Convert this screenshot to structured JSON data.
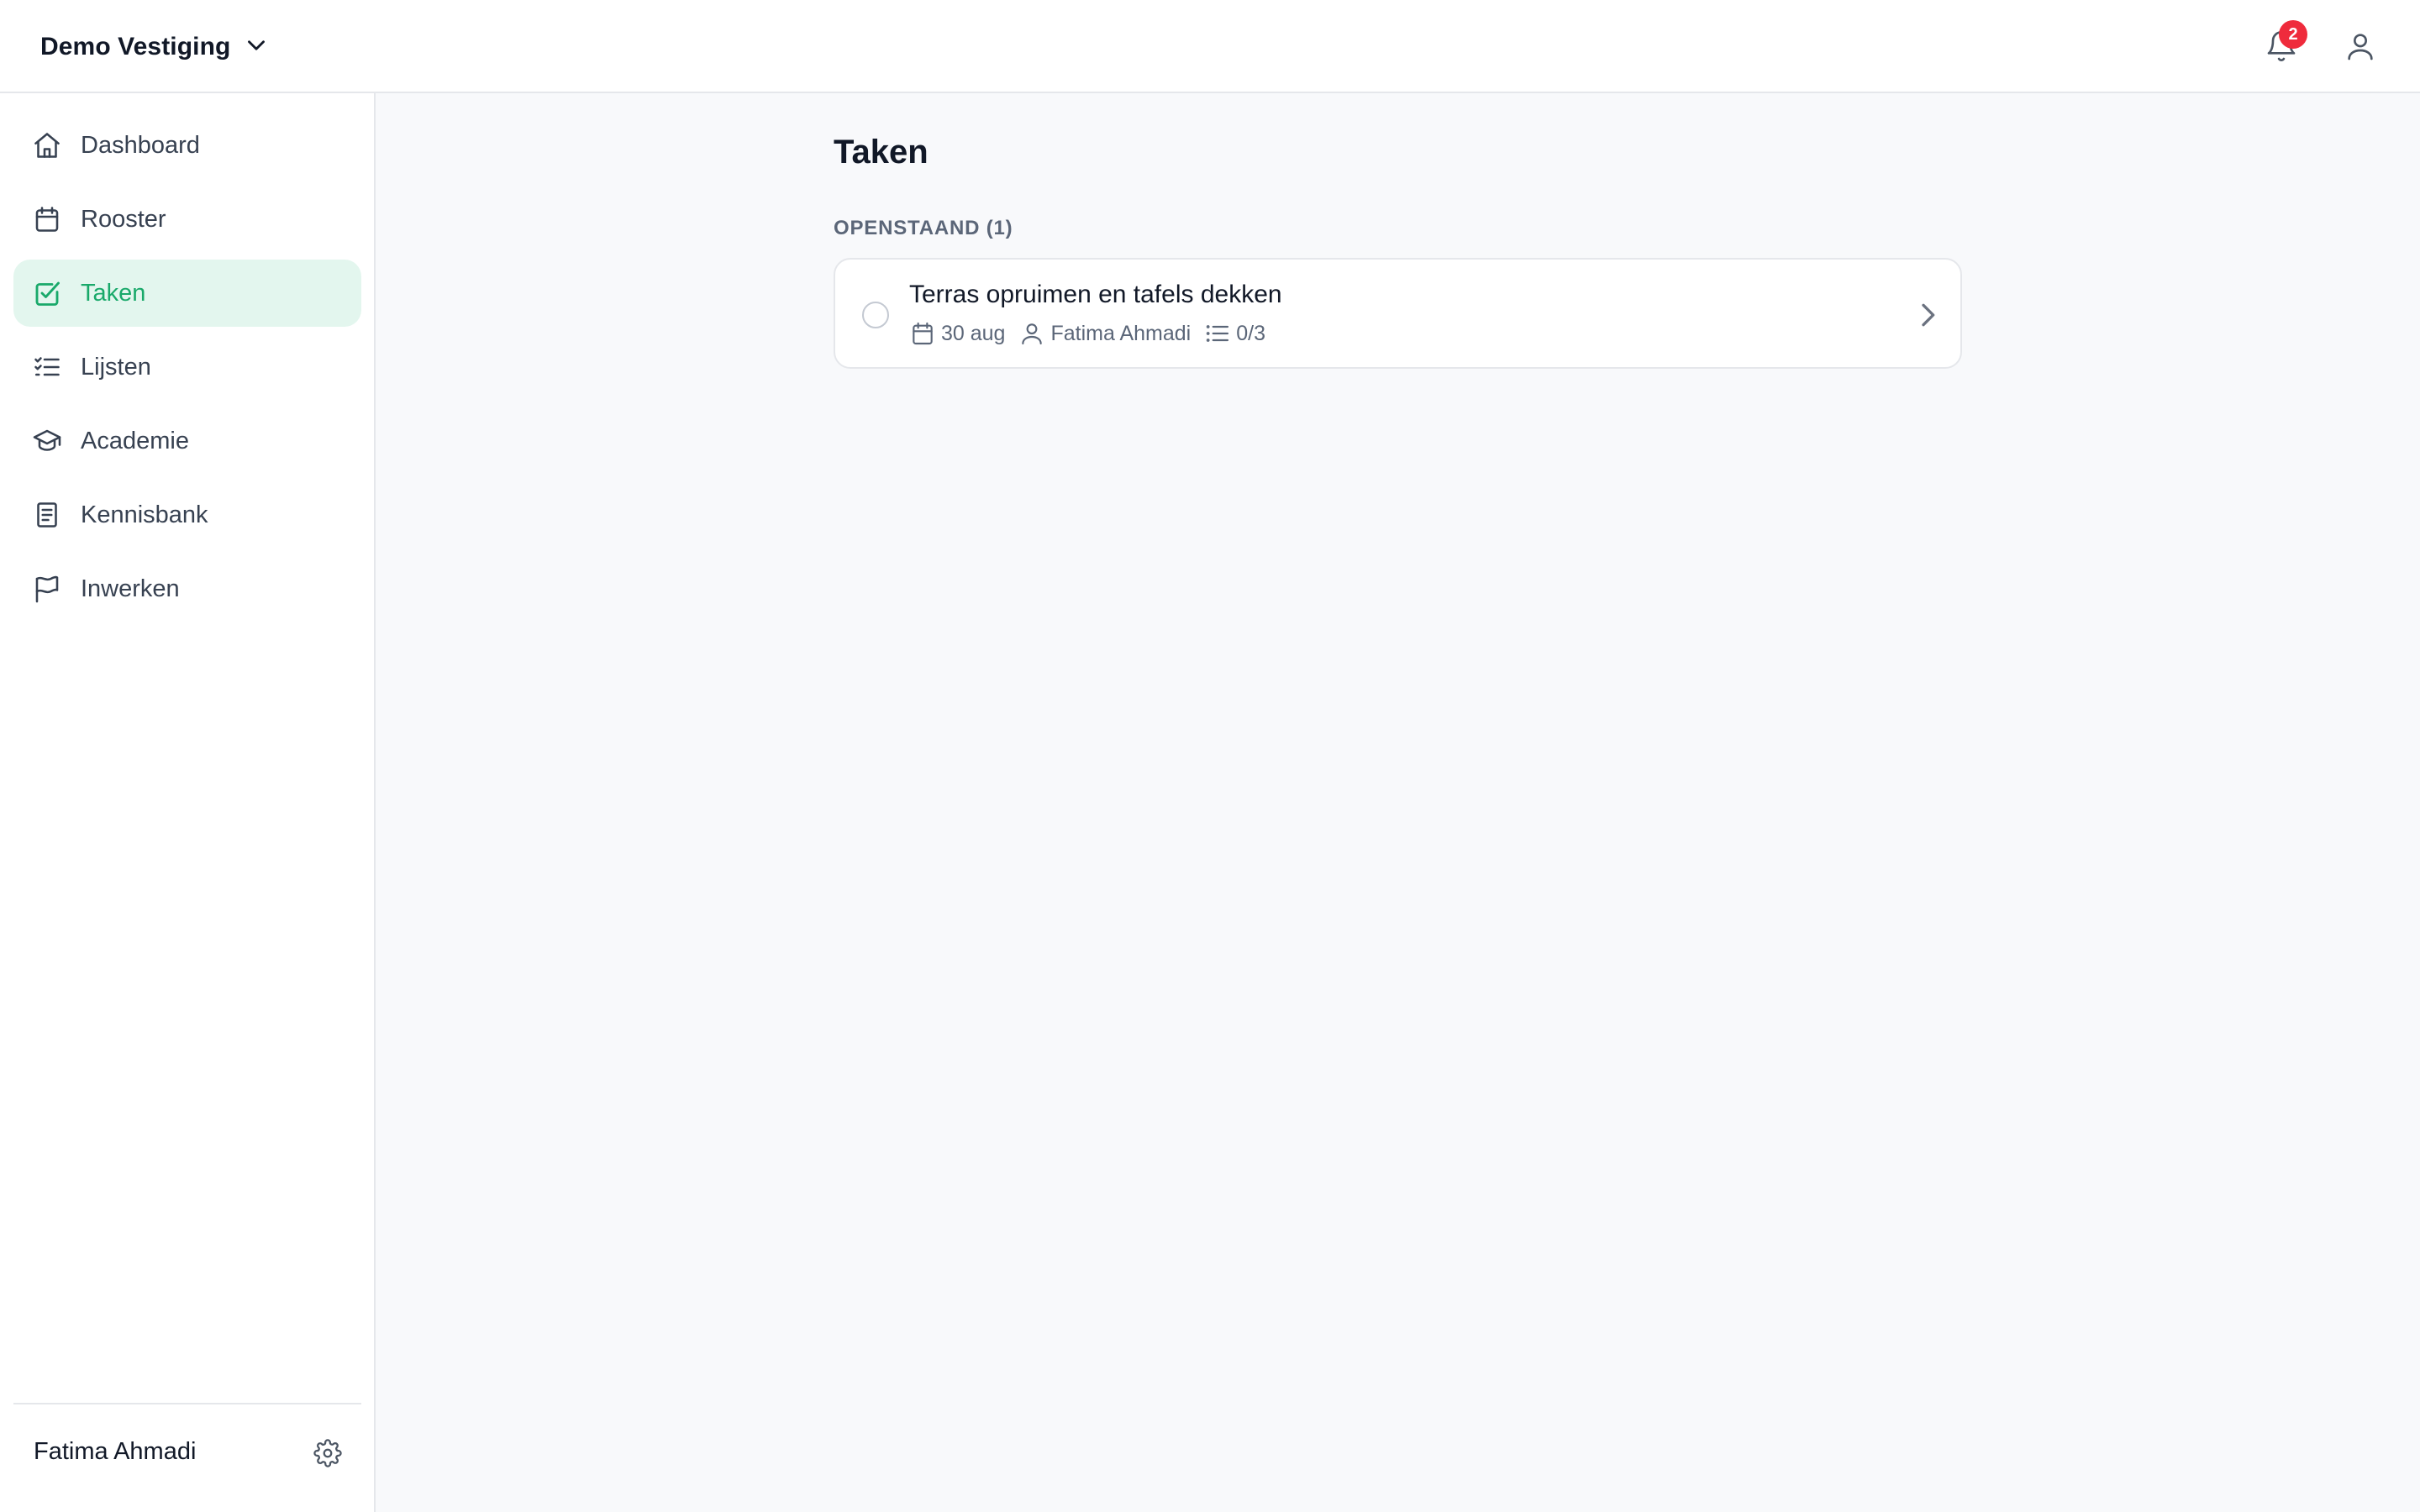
{
  "header": {
    "location_name": "Demo Vestiging",
    "notification_count": "2"
  },
  "sidebar": {
    "items": [
      {
        "label": "Dashboard",
        "icon": "home-icon",
        "active": false
      },
      {
        "label": "Rooster",
        "icon": "calendar-icon",
        "active": false
      },
      {
        "label": "Taken",
        "icon": "check-square-icon",
        "active": true
      },
      {
        "label": "Lijsten",
        "icon": "list-checks-icon",
        "active": false
      },
      {
        "label": "Academie",
        "icon": "graduation-cap-icon",
        "active": false
      },
      {
        "label": "Kennisbank",
        "icon": "book-icon",
        "active": false
      },
      {
        "label": "Inwerken",
        "icon": "flag-icon",
        "active": false
      }
    ],
    "footer_user": "Fatima Ahmadi"
  },
  "main": {
    "title": "Taken",
    "section_label": "OPENSTAAND (1)",
    "tasks": [
      {
        "title": "Terras opruimen en tafels dekken",
        "due_date": "30 aug",
        "assignee": "Fatima Ahmadi",
        "checklist_progress": "0/3"
      }
    ]
  },
  "colors": {
    "accent": "#19a96a",
    "accent_bg": "#e3f6ee",
    "badge": "#ef2b3c"
  }
}
